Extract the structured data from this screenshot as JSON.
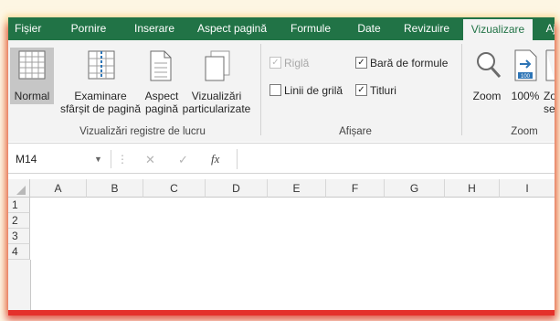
{
  "tabs": [
    {
      "label": "Fișier"
    },
    {
      "label": "Pornire"
    },
    {
      "label": "Inserare"
    },
    {
      "label": "Aspect pagină"
    },
    {
      "label": "Formule"
    },
    {
      "label": "Date"
    },
    {
      "label": "Revizuire"
    },
    {
      "label": "Vizualizare",
      "active": true
    },
    {
      "label": "Aj"
    }
  ],
  "ribbon": {
    "views_group": {
      "normal": "Normal",
      "page_break_line1": "Examinare",
      "page_break_line2": "sfârșit de pagină",
      "page_layout_line1": "Aspect",
      "page_layout_line2": "pagină",
      "custom_line1": "Vizualizări",
      "custom_line2": "particularizate",
      "label": "Vizualizări registre de lucru"
    },
    "show_group": {
      "ruler": "Riglă",
      "gridlines": "Linii de grilă",
      "formula_bar": "Bară de formule",
      "headings": "Titluri",
      "label": "Afișare",
      "ruler_checked": true,
      "ruler_disabled": true,
      "gridlines_checked": false,
      "formula_bar_checked": true,
      "headings_checked": true
    },
    "zoom_group": {
      "zoom": "Zoom",
      "zoom100": "100%",
      "zoom_sel_1": "Zo",
      "zoom_sel_2": "se",
      "label": "Zoom"
    }
  },
  "formula_bar": {
    "name_box": "M14",
    "cancel": "✕",
    "enter": "✓",
    "fx": "fx",
    "formula": ""
  },
  "sheet": {
    "columns": [
      "A",
      "B",
      "C",
      "D",
      "E",
      "F",
      "G",
      "H",
      "I"
    ],
    "rows": [
      "1",
      "2",
      "3",
      "4"
    ]
  },
  "colors": {
    "ribbon_green": "#217346",
    "ribbon_bg": "#f3f3f3",
    "glow_red": "#e4312b"
  }
}
